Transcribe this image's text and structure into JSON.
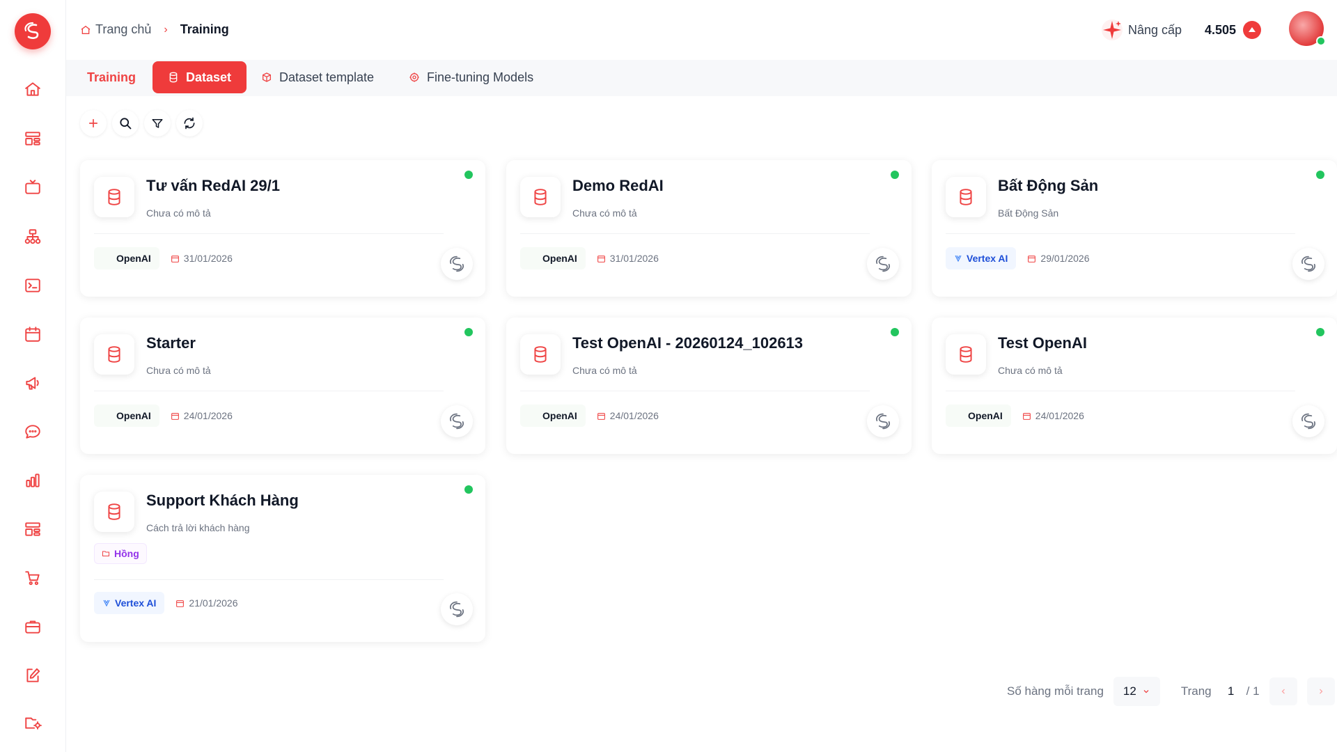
{
  "breadcrumb": {
    "home": "Trang chủ",
    "current": "Training"
  },
  "header": {
    "upgrade_label": "Nâng cấp",
    "credits": "4.505"
  },
  "tabs": [
    {
      "label": "Training"
    },
    {
      "label": "Dataset"
    },
    {
      "label": "Dataset template"
    },
    {
      "label": "Fine-tuning Models"
    }
  ],
  "cards": [
    {
      "title": "Tư vấn RedAI 29/1",
      "description": "Chưa có mô tả",
      "provider": "OpenAI",
      "date": "31/01/2026"
    },
    {
      "title": "Demo RedAI",
      "description": "Chưa có mô tả",
      "provider": "OpenAI",
      "date": "31/01/2026"
    },
    {
      "title": "Bất Động Sản",
      "description": "Bất Động Sản",
      "provider": "Vertex AI",
      "date": "29/01/2026"
    },
    {
      "title": "Starter",
      "description": "Chưa có mô tả",
      "provider": "OpenAI",
      "date": "24/01/2026"
    },
    {
      "title": "Test OpenAI - 20260124_102613",
      "description": "Chưa có mô tả",
      "provider": "OpenAI",
      "date": "24/01/2026"
    },
    {
      "title": "Test OpenAI",
      "description": "Chưa có mô tả",
      "provider": "OpenAI",
      "date": "24/01/2026"
    },
    {
      "title": "Support Khách Hàng",
      "description": "Cách trả lời khách hàng",
      "tag": "Hồng",
      "provider": "Vertex AI",
      "date": "21/01/2026"
    }
  ],
  "pagination": {
    "rows_label": "Số hàng mỗi trang",
    "rows_value": "12",
    "page_label": "Trang",
    "page_value": "1",
    "page_total": "/ 1"
  },
  "colors": {
    "accent": "#ef3b3b",
    "status_active": "#22c55e",
    "vertex": "#1d4ed8",
    "tag": "#9333ea"
  }
}
